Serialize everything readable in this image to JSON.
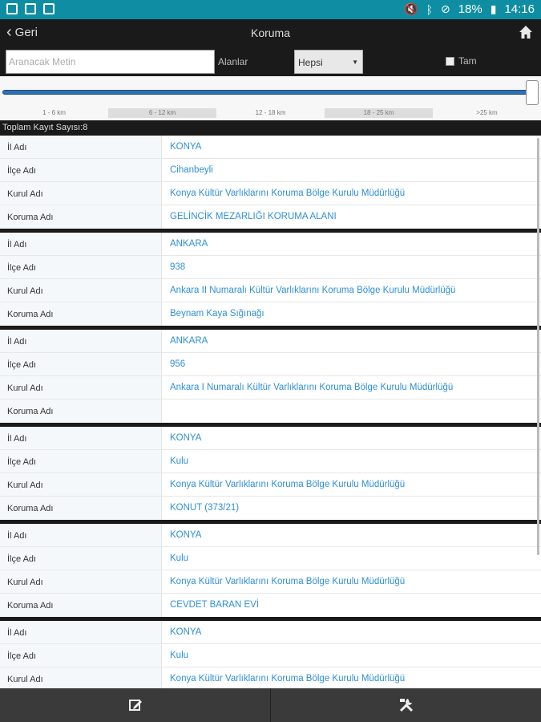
{
  "status": {
    "battery": "18%",
    "time": "14:16"
  },
  "nav": {
    "back_label": "Geri",
    "title": "Koruma"
  },
  "search": {
    "placeholder": "Aranacak Metin",
    "fields_label": "Alanlar",
    "select_value": "Hepsi",
    "exact_label": "Tam"
  },
  "distance_ranges": [
    "1 - 6 km",
    "6 - 12 km",
    "12 - 18 km",
    "18 - 25 km",
    ">25 km"
  ],
  "slider": {
    "selected_fraction": 1.0
  },
  "count_label": "Toplam Kayıt Sayısı:8",
  "labels": {
    "il": "İl Adı",
    "ilce": "İlçe Adı",
    "kurul": "Kurul Adı",
    "koruma": "Koruma Adı"
  },
  "records": [
    {
      "il": "KONYA",
      "ilce": "Cihanbeyli",
      "kurul": "Konya Kültür Varlıklarını Koruma Bölge Kurulu Müdürlüğü",
      "koruma": "GELİNCİK MEZARLIĞI KORUMA ALANI"
    },
    {
      "il": "ANKARA",
      "ilce": "938",
      "kurul": "Ankara II Numaralı Kültür Varlıklarını Koruma Bölge Kurulu Müdürlüğü",
      "koruma": "Beynam Kaya Sığınağı"
    },
    {
      "il": "ANKARA",
      "ilce": "956",
      "kurul": "Ankara I Numaralı Kültür Varlıklarını Koruma Bölge Kurulu Müdürlüğü",
      "koruma": ""
    },
    {
      "il": "KONYA",
      "ilce": "Kulu",
      "kurul": "Konya Kültür Varlıklarını Koruma Bölge Kurulu Müdürlüğü",
      "koruma": "KONUT (373/21)"
    },
    {
      "il": "KONYA",
      "ilce": "Kulu",
      "kurul": "Konya Kültür Varlıklarını Koruma Bölge Kurulu Müdürlüğü",
      "koruma": "CEVDET BARAN EVİ"
    },
    {
      "il": "KONYA",
      "ilce": "Kulu",
      "kurul": "Konya Kültür Varlıklarını Koruma Bölge Kurulu Müdürlüğü",
      "koruma": ""
    }
  ],
  "icons": {
    "back": "chevron-left-icon",
    "home": "home-icon",
    "edit": "edit-icon",
    "tools": "tools-icon"
  }
}
